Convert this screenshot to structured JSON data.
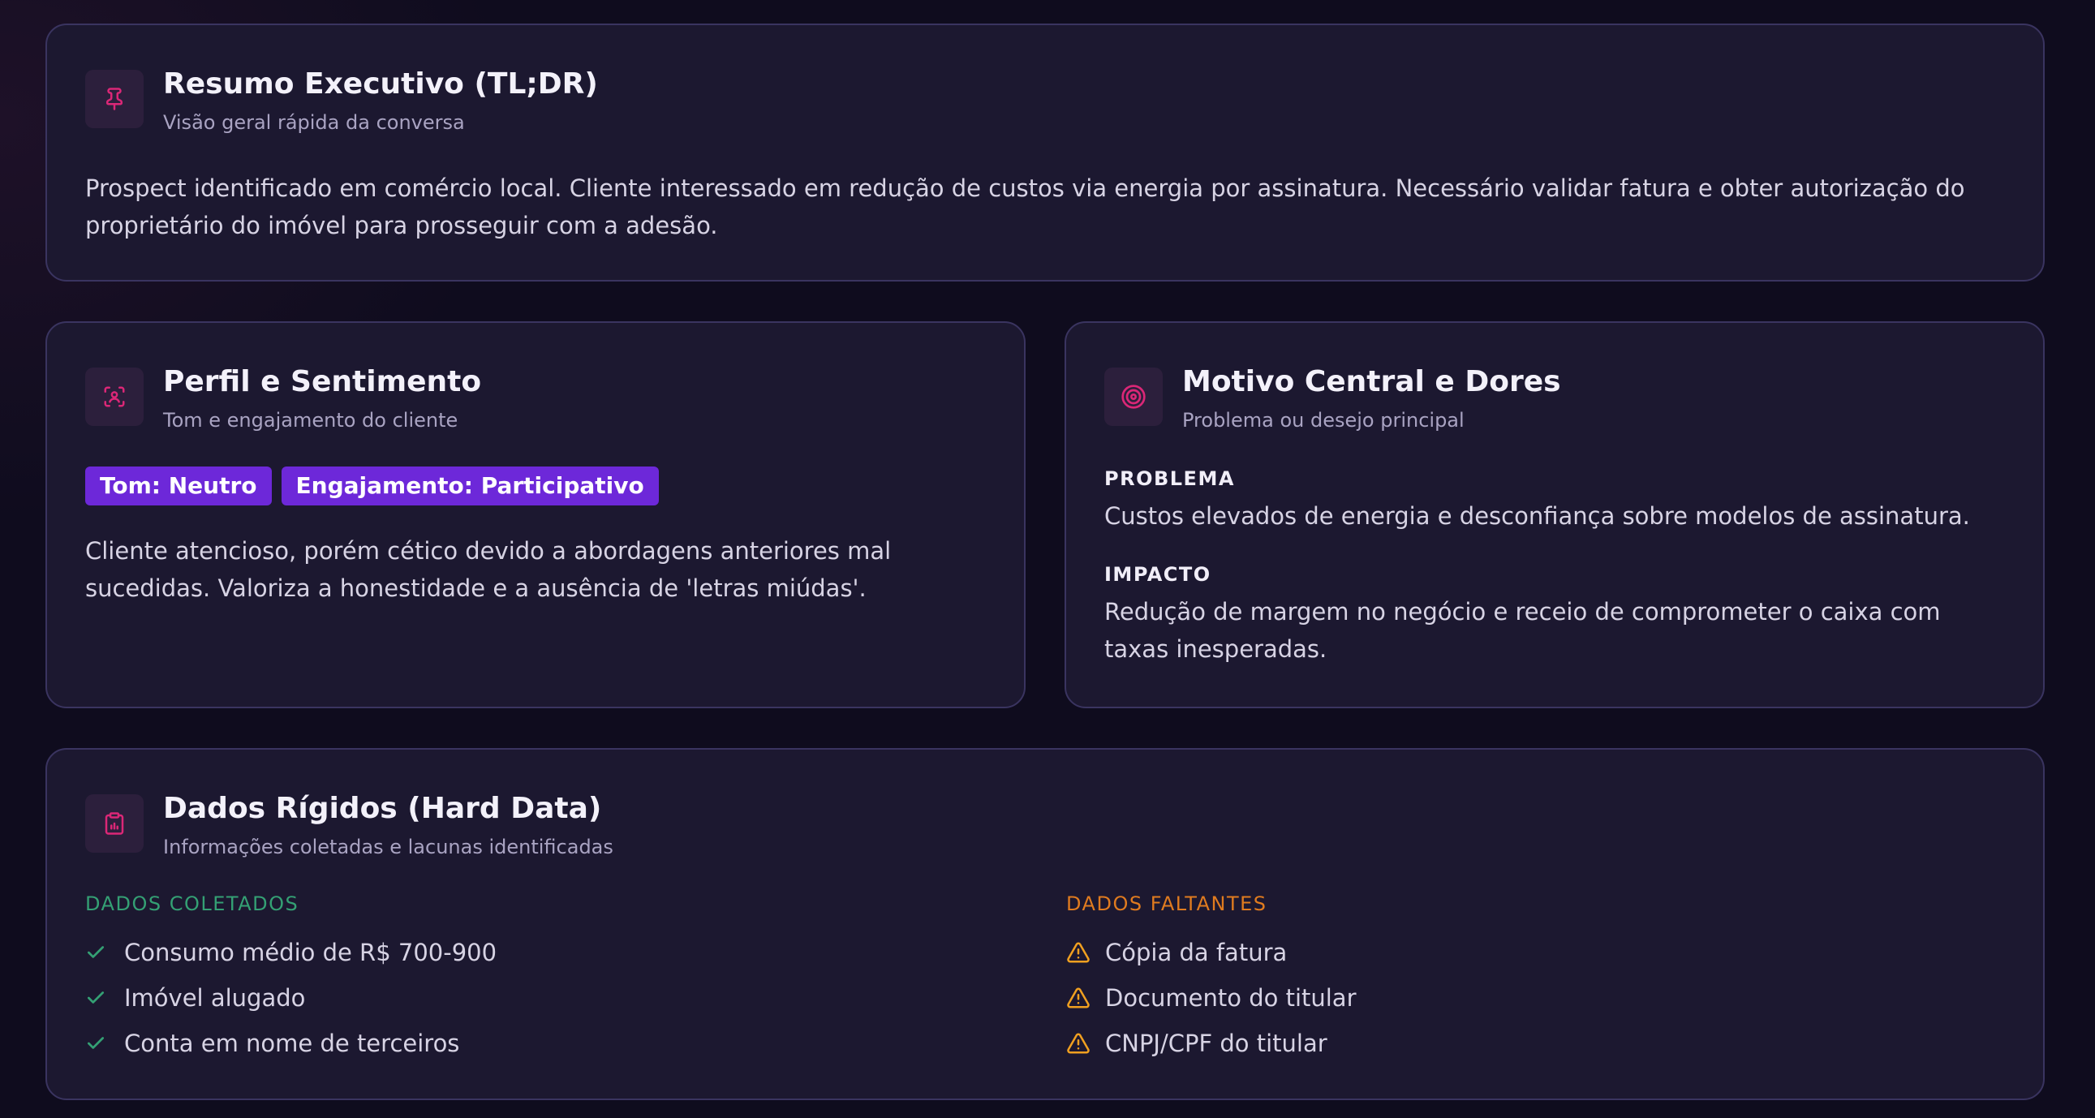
{
  "colors": {
    "accent_pink": "#db2777",
    "badge_purple": "#6d28d9",
    "success_green": "#34a074",
    "warning_orange": "#f0a020",
    "card_bg": "#1c1830"
  },
  "summary": {
    "icon": "pin-icon",
    "title": "Resumo Executivo (TL;DR)",
    "subtitle": "Visão geral rápida da conversa",
    "text": "Prospect identificado em comércio local. Cliente interessado em redução de custos via energia por assinatura. Necessário validar fatura e obter autorização do proprietário do imóvel para prosseguir com a adesão."
  },
  "profile": {
    "icon": "face-scan-icon",
    "title": "Perfil e Sentimento",
    "subtitle": "Tom e engajamento do cliente",
    "badges": [
      "Tom: Neutro",
      "Engajamento: Participativo"
    ],
    "text": "Cliente atencioso, porém cético devido a abordagens anteriores mal sucedidas. Valoriza a honestidade e a ausência de 'letras miúdas'."
  },
  "motive": {
    "icon": "target-icon",
    "title": "Motivo Central e Dores",
    "subtitle": "Problema ou desejo principal",
    "problem_label": "PROBLEMA",
    "problem_text": "Custos elevados de energia e desconfiança sobre modelos de assinatura.",
    "impact_label": "IMPACTO",
    "impact_text": "Redução de margem no negócio e receio de comprometer o caixa com taxas inesperadas."
  },
  "hard_data": {
    "icon": "clipboard-chart-icon",
    "title": "Dados Rígidos (Hard Data)",
    "subtitle": "Informações coletadas e lacunas identificadas",
    "collected_label": "DADOS COLETADOS",
    "collected": [
      "Consumo médio de R$ 700-900",
      "Imóvel alugado",
      "Conta em nome de terceiros"
    ],
    "missing_label": "DADOS FALTANTES",
    "missing": [
      "Cópia da fatura",
      "Documento do titular",
      "CNPJ/CPF do titular"
    ]
  }
}
